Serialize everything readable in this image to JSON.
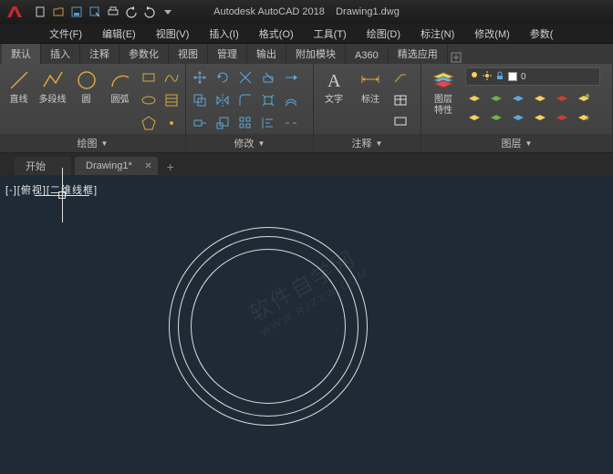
{
  "app": {
    "name": "Autodesk AutoCAD 2018",
    "file": "Drawing1.dwg"
  },
  "menus": [
    "文件(F)",
    "编辑(E)",
    "视图(V)",
    "插入(I)",
    "格式(O)",
    "工具(T)",
    "绘图(D)",
    "标注(N)",
    "修改(M)",
    "参数("
  ],
  "ribbon_tabs": [
    "默认",
    "插入",
    "注释",
    "参数化",
    "视图",
    "管理",
    "输出",
    "附加模块",
    "A360",
    "精选应用"
  ],
  "active_ribbon_tab": "默认",
  "panels": {
    "draw": {
      "title": "绘图",
      "line": "直线",
      "polyline": "多段线",
      "circle": "圆",
      "arc": "圆弧"
    },
    "modify": {
      "title": "修改"
    },
    "annotate": {
      "title": "注释",
      "text": "文字",
      "dim": "标注"
    },
    "layers": {
      "title": "图层",
      "props": "图层\n特性",
      "current": "0"
    }
  },
  "doc_tabs": {
    "start": "开始",
    "drawing": "Drawing1*"
  },
  "viewport": {
    "label": "[-][俯视][二维线框]"
  },
  "watermark": {
    "main": "软件自学网",
    "sub": "WWW.RJZXW.COM"
  }
}
